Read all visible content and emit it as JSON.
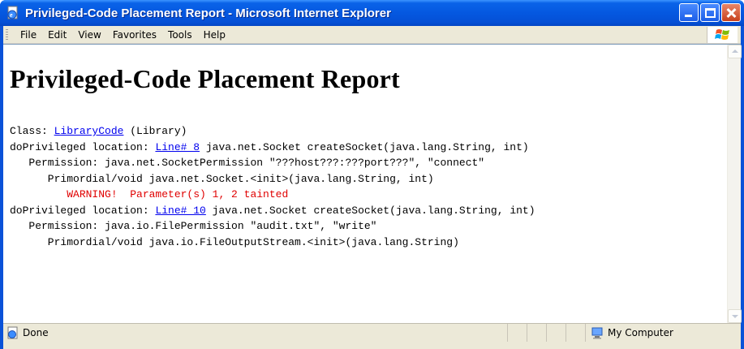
{
  "window": {
    "title": "Privileged-Code Placement Report - Microsoft Internet Explorer"
  },
  "menu": {
    "items": [
      "File",
      "Edit",
      "View",
      "Favorites",
      "Tools",
      "Help"
    ]
  },
  "page": {
    "heading": "Privileged-Code Placement Report",
    "class_line": {
      "prefix": "Class: ",
      "link": "LibraryCode",
      "suffix": " (Library)"
    },
    "blocks": [
      {
        "location_prefix": "doPrivileged location: ",
        "location_link": "Line# 8",
        "location_suffix": " java.net.Socket createSocket(java.lang.String, int)",
        "permission": "   Permission: java.net.SocketPermission \"???host???:???port???\", \"connect\"",
        "frame": "      Primordial/void java.net.Socket.<init>(java.lang.String, int)",
        "warning": "         WARNING!  Parameter(s) 1, 2 tainted"
      },
      {
        "location_prefix": "doPrivileged location: ",
        "location_link": "Line# 10",
        "location_suffix": " java.net.Socket createSocket(java.lang.String, int)",
        "permission": "   Permission: java.io.FilePermission \"audit.txt\", \"write\"",
        "frame": "      Primordial/void java.io.FileOutputStream.<init>(java.lang.String)"
      }
    ]
  },
  "status": {
    "text": "Done",
    "zone": "My Computer"
  },
  "colors": {
    "link": "#0000ee",
    "warning": "#e00000",
    "titlebar": "#0558e0"
  }
}
